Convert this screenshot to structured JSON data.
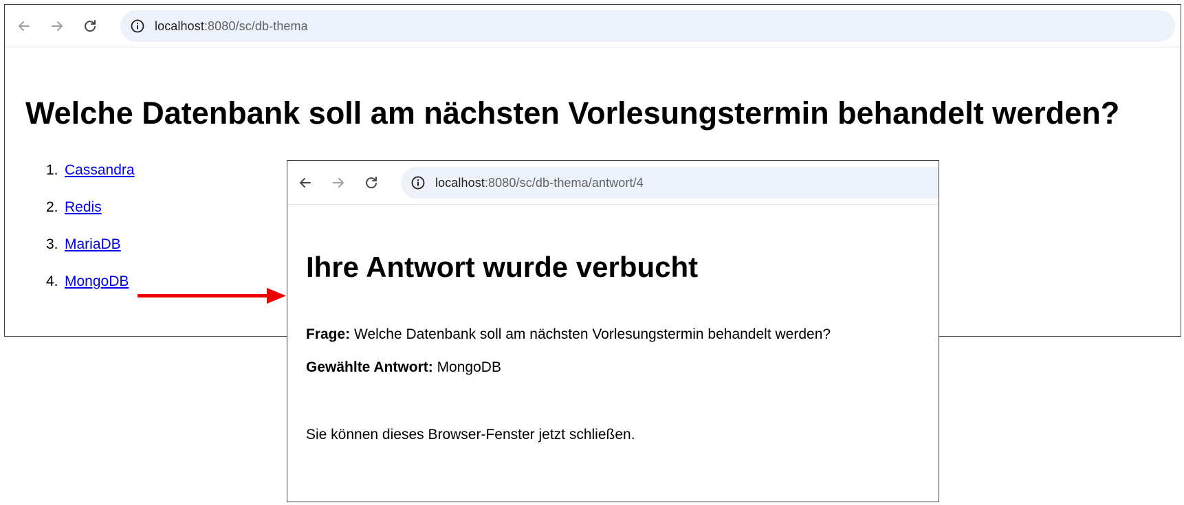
{
  "main_window": {
    "url_host": "localhost",
    "url_path": ":8080/sc/db-thema",
    "title": "Welche Datenbank soll am nächsten Vorlesungstermin behandelt werden?",
    "options": [
      {
        "number": "1.",
        "label": "Cassandra"
      },
      {
        "number": "2.",
        "label": "Redis"
      },
      {
        "number": "3.",
        "label": "MariaDB"
      },
      {
        "number": "4.",
        "label": "MongoDB"
      }
    ]
  },
  "answer_window": {
    "url_host": "localhost",
    "url_path": ":8080/sc/db-thema/antwort/4",
    "title": "Ihre Antwort wurde verbucht",
    "question_label": "Frage:",
    "question_text": " Welche Datenbank soll am nächsten Vorlesungstermin behandelt werden?",
    "chosen_label": "Gewählte Antwort:",
    "chosen_text": " MongoDB",
    "close_text": "Sie können dieses Browser-Fenster jetzt schließen."
  },
  "colors": {
    "link": "#0000ee",
    "arrow": "#ee0000",
    "omnibox": "#edf2fa"
  },
  "icons": [
    "back-arrow-icon",
    "forward-arrow-icon",
    "reload-icon",
    "info-icon",
    "red-arrow-icon"
  ]
}
